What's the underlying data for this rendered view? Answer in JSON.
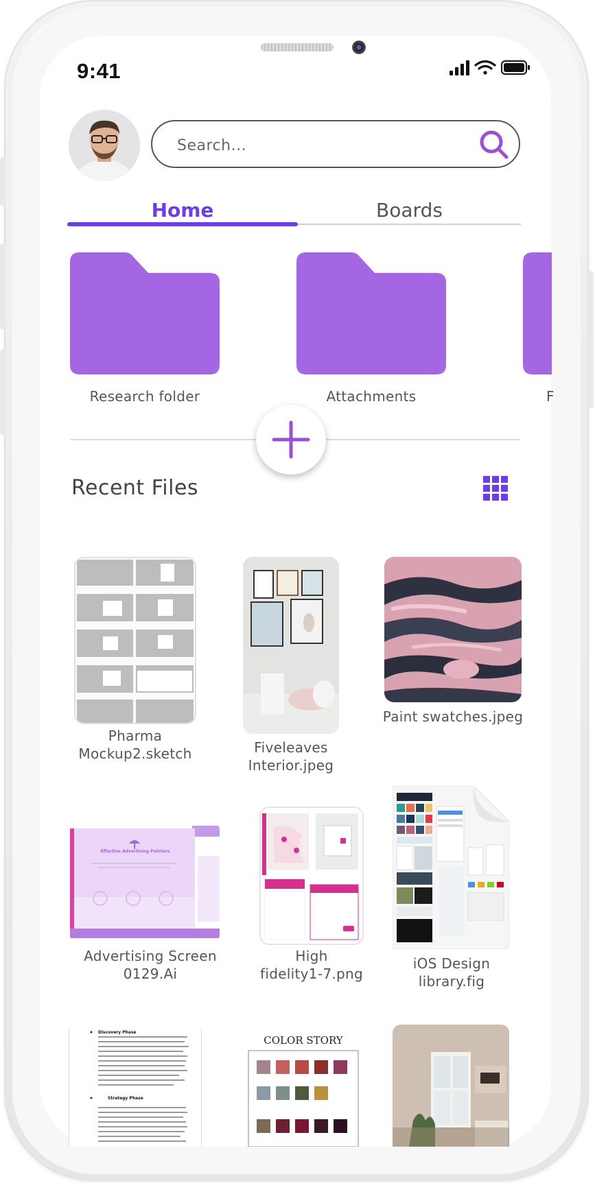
{
  "status_bar": {
    "time": "9:41"
  },
  "search": {
    "placeholder": "Search..."
  },
  "tabs": [
    {
      "label": "Home",
      "active": true
    },
    {
      "label": "Boards",
      "active": false
    }
  ],
  "folders": [
    {
      "label": "Research folder"
    },
    {
      "label": "Attachments"
    },
    {
      "label": "F"
    }
  ],
  "recent_files": {
    "title": "Recent Files",
    "items": [
      {
        "name": "Pharma\nMockup2.sketch"
      },
      {
        "name": "Fiveleaves\nInterior.jpeg"
      },
      {
        "name": "Paint swatches.jpeg"
      },
      {
        "name": "Advertising Screen\n0129.Ai"
      },
      {
        "name": "High\nfidelity1-7.png"
      },
      {
        "name": "iOS Design\nlibrary.fig"
      }
    ]
  },
  "thumbnails": {
    "advertising_title": "Effective Advertising Pointers",
    "color_story_title": "COLOR STORY",
    "doc_phase_1": "Discovery Phase",
    "doc_phase_2": "Strategy Phase"
  },
  "colors": {
    "accent": "#6b3cf0",
    "folder": "#a466e2",
    "plus": "#9b4fd6"
  },
  "icons": {
    "search": "search-icon",
    "add": "plus-icon",
    "grid": "grid-view-icon",
    "folder": "folder-icon"
  }
}
